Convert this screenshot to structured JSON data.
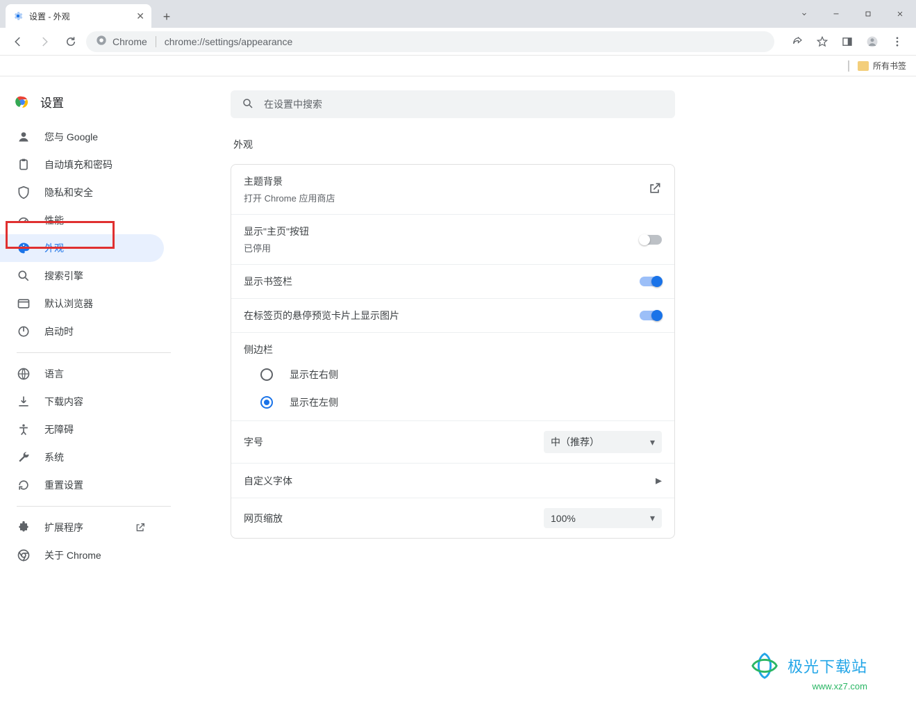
{
  "tab": {
    "title": "设置 - 外观"
  },
  "omnibox": {
    "prefix": "Chrome",
    "url": "chrome://settings/appearance"
  },
  "bookmarks": {
    "all": "所有书签"
  },
  "sidebar": {
    "title": "设置",
    "items": [
      {
        "label": "您与 Google"
      },
      {
        "label": "自动填充和密码"
      },
      {
        "label": "隐私和安全"
      },
      {
        "label": "性能"
      },
      {
        "label": "外观"
      },
      {
        "label": "搜索引擎"
      },
      {
        "label": "默认浏览器"
      },
      {
        "label": "启动时"
      }
    ],
    "items2": [
      {
        "label": "语言"
      },
      {
        "label": "下载内容"
      },
      {
        "label": "无障碍"
      },
      {
        "label": "系统"
      },
      {
        "label": "重置设置"
      }
    ],
    "items3": [
      {
        "label": "扩展程序"
      },
      {
        "label": "关于 Chrome"
      }
    ]
  },
  "content": {
    "search_placeholder": "在设置中搜索",
    "section": "外观",
    "theme": {
      "title": "主题背景",
      "sub": "打开 Chrome 应用商店"
    },
    "home": {
      "title": "显示\"主页\"按钮",
      "sub": "已停用"
    },
    "row_bookmarks": "显示书签栏",
    "row_hover": "在标签页的悬停预览卡片上显示图片",
    "sidepanel": {
      "header": "侧边栏",
      "right": "显示在右侧",
      "left": "显示在左侧"
    },
    "fontsize": {
      "label": "字号",
      "value": "中（推荐）"
    },
    "customfont": {
      "label": "自定义字体"
    },
    "zoom": {
      "label": "网页缩放",
      "value": "100%"
    }
  },
  "watermark": {
    "text": "极光下载站",
    "url": "www.xz7.com"
  }
}
